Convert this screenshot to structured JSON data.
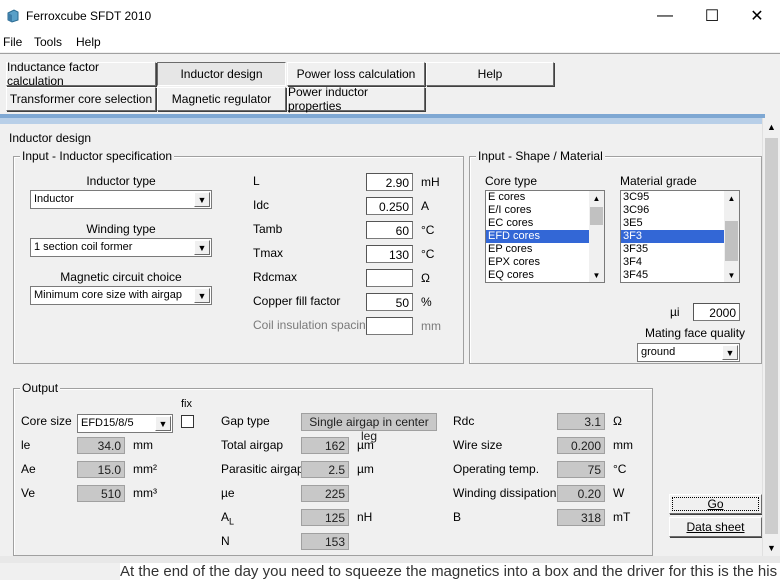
{
  "window": {
    "title": "Ferroxcube SFDT 2010",
    "controls": {
      "minimize": "—",
      "maximize": "☐",
      "close": "✕"
    }
  },
  "menu": {
    "file": "File",
    "tools": "Tools",
    "help": "Help"
  },
  "toolbar": {
    "row1": [
      "Inductance factor calculation",
      "Inductor design",
      "Power loss calculation",
      "Help"
    ],
    "row2": [
      "Transformer core selection",
      "Magnetic regulator",
      "Power inductor properties"
    ],
    "active": "Inductor design"
  },
  "section_title": "Inductor design",
  "spec": {
    "legend": "Input - Inductor specification",
    "inductor_type_label": "Inductor type",
    "inductor_type_value": "Inductor",
    "winding_type_label": "Winding type",
    "winding_type_value": "1 section coil former",
    "magnetic_circuit_label": "Magnetic circuit choice",
    "magnetic_circuit_value": "Minimum core size with airgap",
    "fields": {
      "L": {
        "label": "L",
        "value": "2.90",
        "unit": "mH"
      },
      "Idc": {
        "label": "Idc",
        "value": "0.250",
        "unit": "A"
      },
      "Tamb": {
        "label": "Tamb",
        "value": "60",
        "unit": "°C"
      },
      "Tmax": {
        "label": "Tmax",
        "value": "130",
        "unit": "°C"
      },
      "Rdcmax": {
        "label": "Rdcmax",
        "value": "",
        "unit": "Ω"
      },
      "copper_fill": {
        "label": "Copper fill factor",
        "value": "50",
        "unit": "%"
      },
      "coil_insulation": {
        "label": "Coil insulation spacing",
        "value": "",
        "unit": "mm"
      }
    }
  },
  "shape": {
    "legend": "Input - Shape / Material",
    "core_type_label": "Core type",
    "core_types": [
      "E cores",
      "E/I cores",
      "EC cores",
      "EFD cores",
      "EP cores",
      "EPX cores",
      "EQ cores"
    ],
    "core_type_selected": "EFD cores",
    "material_label": "Material grade",
    "materials": [
      "3C95",
      "3C96",
      "3E5",
      "3F3",
      "3F35",
      "3F4",
      "3F45"
    ],
    "material_selected": "3F3",
    "mu_label": "µi",
    "mu_value": "2000",
    "mating_label": "Mating face quality",
    "mating_value": "ground"
  },
  "output": {
    "legend": "Output",
    "core_size_label": "Core size",
    "core_size_value": "EFD15/8/5",
    "fix_label": "fix",
    "le": {
      "label": "le",
      "value": "34.0",
      "unit": "mm"
    },
    "Ae": {
      "label": "Ae",
      "value": "15.0",
      "unit": "mm²"
    },
    "Ve": {
      "label": "Ve",
      "value": "510",
      "unit": "mm³"
    },
    "gap_type": {
      "label": "Gap type",
      "value": "Single airgap in center leg"
    },
    "total_airgap": {
      "label": "Total airgap",
      "value": "162",
      "unit": "µm"
    },
    "parasitic_airgap": {
      "label": "Parasitic airgap",
      "value": "2.5",
      "unit": "µm"
    },
    "mu_e": {
      "label": "µe",
      "value": "225"
    },
    "AL": {
      "label": "A",
      "sub": "L",
      "value": "125",
      "unit": "nH"
    },
    "N": {
      "label": "N",
      "value": "153"
    },
    "Rdc": {
      "label": "Rdc",
      "value": "3.1",
      "unit": "Ω"
    },
    "wire_size": {
      "label": "Wire size",
      "value": "0.200",
      "unit": "mm"
    },
    "op_temp": {
      "label": "Operating temp.",
      "value": "75",
      "unit": "°C"
    },
    "winding_dissipation": {
      "label": "Winding dissipation",
      "value": "0.20",
      "unit": "W"
    },
    "B": {
      "label": "B",
      "value": "318",
      "unit": "mT"
    }
  },
  "actions": {
    "go": "Go",
    "datasheet": "Data sheet"
  },
  "background_text": "At the end of the day you need to squeeze the magnetics into a box and the driver for this is the his"
}
